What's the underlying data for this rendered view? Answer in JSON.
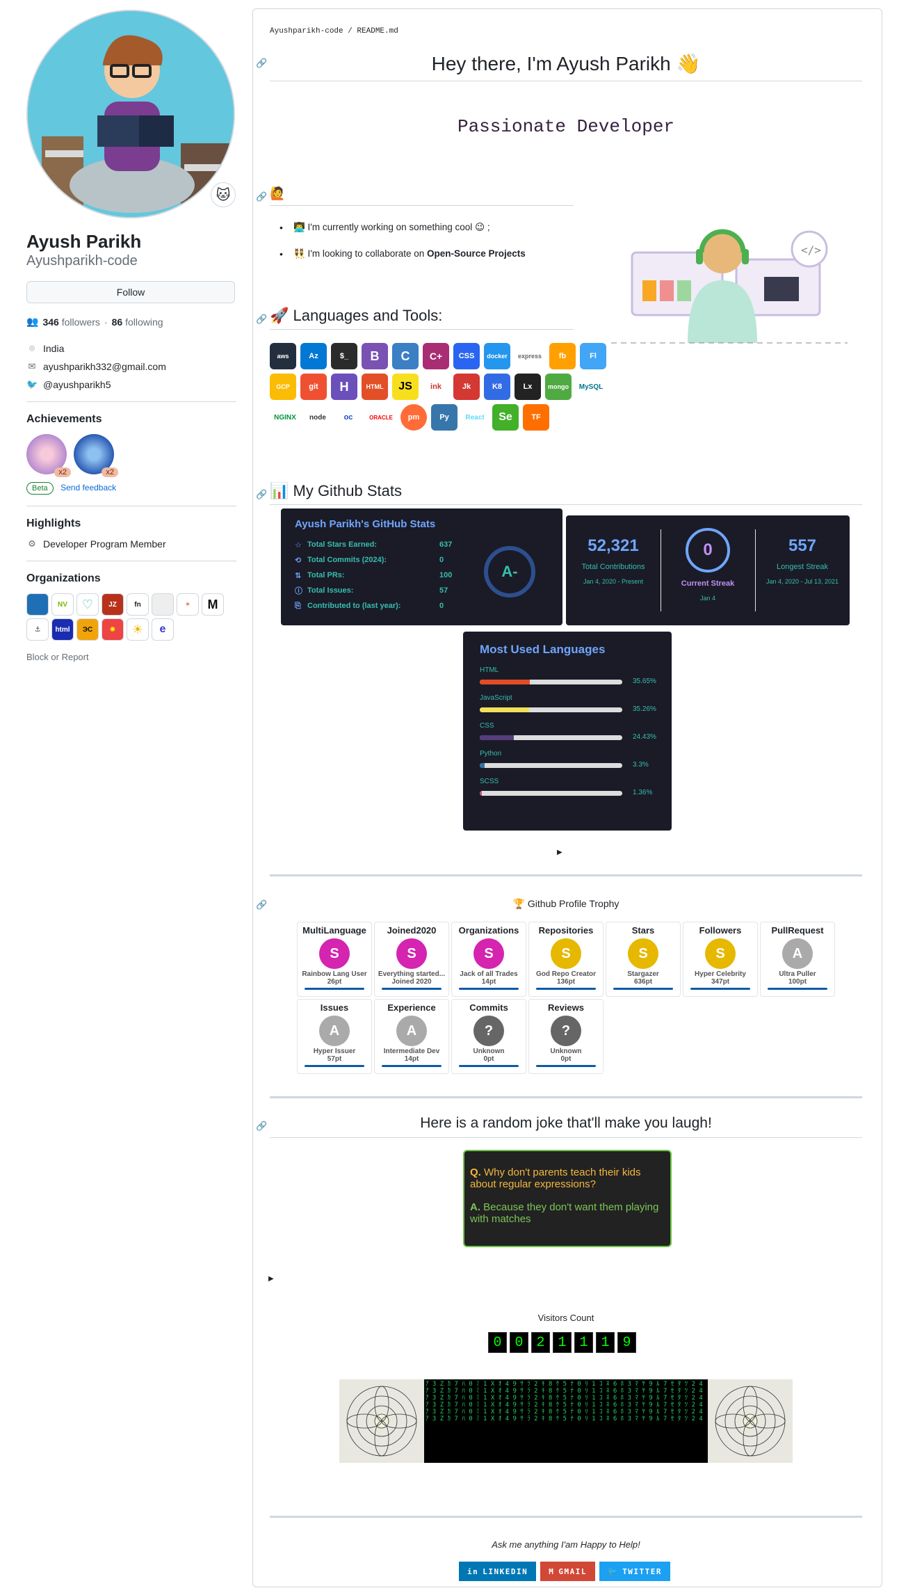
{
  "profile": {
    "name": "Ayush Parikh",
    "login": "Ayushparikh-code",
    "follow_label": "Follow",
    "followers": "346",
    "followers_label": "followers",
    "following": "86",
    "following_label": "following",
    "location": "India",
    "email": "ayushparikh332@gmail.com",
    "twitter": "@ayushparikh5",
    "achievements_title": "Achievements",
    "achievement_counts": [
      "x2",
      "x2"
    ],
    "beta_label": "Beta",
    "feedback_label": "Send feedback",
    "highlights_title": "Highlights",
    "highlight_item": "Developer Program Member",
    "orgs_title": "Organizations",
    "block_label": "Block or Report"
  },
  "readme": {
    "breadcrumb": "Ayushparikh-code / README.md",
    "title": "Hey there, I'm Ayush Parikh 👋",
    "typing": "Passionate Developer",
    "wave_emoji": "🙋",
    "bullets": [
      "👨‍💻 I'm currently working on something cool 😉 ;",
      "👯 I'm looking to collaborate on",
      "Open-Source Projects"
    ],
    "tools_heading": "🚀 Languages and Tools:",
    "tools": [
      "aws",
      "Az",
      "$_",
      "B",
      "C",
      "C+",
      "CSS",
      "docker",
      "express",
      "fb",
      "Fl",
      "GCP",
      "git",
      "H",
      "HTML",
      "JS",
      "ink",
      "Jk",
      "K8",
      "Lx",
      "mongo",
      "MySQL",
      "NGINX",
      "node",
      "oc",
      "ORACLE",
      "pm",
      "Py",
      "React",
      "Se",
      "TF"
    ],
    "stats_heading": "📊 My Github Stats",
    "trophy_heading": "🏆 Github Profile Trophy",
    "joke_heading": "Here is a random joke that'll make you laugh!",
    "visitors_label": "Visitors Count",
    "visitor_digits": [
      "0",
      "0",
      "2",
      "1",
      "1",
      "1",
      "9"
    ],
    "footer_text": "Ask me anything I'am Happy to Help!",
    "buttons": [
      "LINKEDIN",
      "GMAIL",
      "TWITTER"
    ],
    "toggle_arrow": "▶"
  },
  "stats_card": {
    "title": "Ayush Parikh's GitHub Stats",
    "rows": [
      {
        "label": "Total Stars Earned:",
        "value": "637"
      },
      {
        "label": "Total Commits (2024):",
        "value": "0"
      },
      {
        "label": "Total PRs:",
        "value": "100"
      },
      {
        "label": "Total Issues:",
        "value": "57"
      },
      {
        "label": "Contributed to (last year):",
        "value": "0"
      }
    ],
    "grade": "A-"
  },
  "streak_card": {
    "total": "52,321",
    "total_label": "Total Contributions",
    "total_range": "Jan 4, 2020 - Present",
    "current": "0",
    "current_label": "Current Streak",
    "current_date": "Jan 4",
    "longest": "557",
    "longest_label": "Longest Streak",
    "longest_range": "Jan 4, 2020 - Jul 13, 2021"
  },
  "languages_card": {
    "title": "Most Used Languages",
    "langs": [
      {
        "name": "HTML",
        "pct": 35.65,
        "label": "35.65%",
        "color": "#e34c26"
      },
      {
        "name": "JavaScript",
        "pct": 35.26,
        "label": "35.26%",
        "color": "#f1e05a"
      },
      {
        "name": "CSS",
        "pct": 24.43,
        "label": "24.43%",
        "color": "#563d7c"
      },
      {
        "name": "Python",
        "pct": 3.3,
        "label": "3.3%",
        "color": "#3572A5"
      },
      {
        "name": "SCSS",
        "pct": 1.36,
        "label": "1.36%",
        "color": "#c6538c"
      }
    ]
  },
  "trophies": [
    {
      "title": "MultiLanguage",
      "rank": "S",
      "name": "Rainbow Lang User",
      "pts": "26pt",
      "color": "#d424b0"
    },
    {
      "title": "Joined2020",
      "rank": "S",
      "name": "Everything started...",
      "pts": "Joined 2020",
      "color": "#d424b0"
    },
    {
      "title": "Organizations",
      "rank": "S",
      "name": "Jack of all Trades",
      "pts": "14pt",
      "color": "#d424b0"
    },
    {
      "title": "Repositories",
      "rank": "S",
      "name": "God Repo Creator",
      "pts": "136pt",
      "color": "#e6b800"
    },
    {
      "title": "Stars",
      "rank": "S",
      "name": "Stargazer",
      "pts": "636pt",
      "color": "#e6b800"
    },
    {
      "title": "Followers",
      "rank": "S",
      "name": "Hyper Celebrity",
      "pts": "347pt",
      "color": "#e6b800"
    },
    {
      "title": "PullRequest",
      "rank": "A",
      "name": "Ultra Puller",
      "pts": "100pt",
      "color": "#aaaaaa"
    },
    {
      "title": "Issues",
      "rank": "A",
      "name": "Hyper Issuer",
      "pts": "57pt",
      "color": "#aaaaaa"
    },
    {
      "title": "Experience",
      "rank": "A",
      "name": "Intermediate Dev",
      "pts": "14pt",
      "color": "#aaaaaa"
    },
    {
      "title": "Commits",
      "rank": "?",
      "name": "Unknown",
      "pts": "0pt",
      "color": "#666666"
    },
    {
      "title": "Reviews",
      "rank": "?",
      "name": "Unknown",
      "pts": "0pt",
      "color": "#666666"
    }
  ],
  "joke": {
    "q_prefix": "Q.",
    "question": "Why don't parents teach their kids about regular expressions?",
    "a_prefix": "A.",
    "answer": "Because they don't want them playing with matches"
  }
}
